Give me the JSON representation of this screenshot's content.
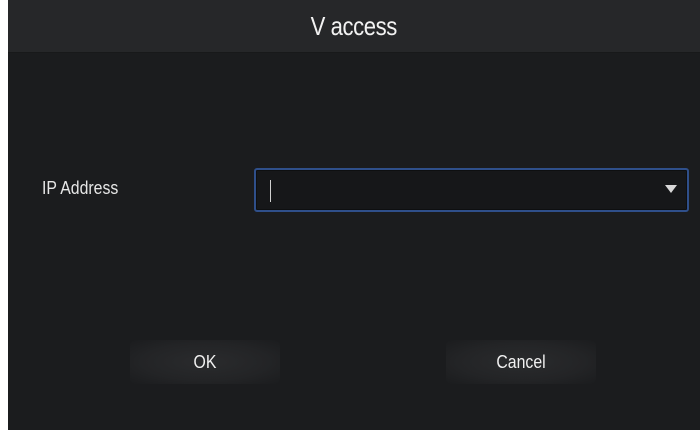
{
  "dialog": {
    "title": "V access",
    "ip_field": {
      "label": "IP Address",
      "value": "",
      "dropdown_icon": "chevron-down-icon"
    },
    "buttons": {
      "ok_label": "OK",
      "cancel_label": "Cancel"
    }
  },
  "colors": {
    "background": "#1b1c1e",
    "title_bar": "#262729",
    "input_border_focus": "#2f4f8a",
    "text": "#f0f0f0"
  }
}
